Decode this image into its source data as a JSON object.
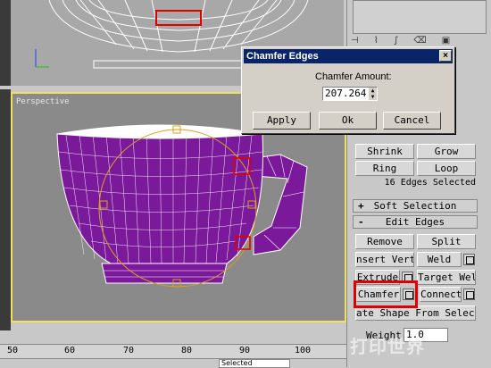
{
  "viewport": {
    "perspective_label": "Perspective"
  },
  "dialog": {
    "title": "Chamfer Edges",
    "amount_label": "Chamfer Amount:",
    "amount_value": "207.264",
    "apply_label": "Apply",
    "ok_label": "Ok",
    "cancel_label": "Cancel",
    "close_glyph": "×"
  },
  "panel": {
    "shrink_label": "Shrink",
    "grow_label": "Grow",
    "ring_label": "Ring",
    "loop_label": "Loop",
    "selection_status": "16 Edges Selected",
    "soft_selection_label": "Soft Selection",
    "soft_selection_glyph": "+",
    "edit_edges_label": "Edit Edges",
    "edit_edges_glyph": "-",
    "remove_label": "Remove",
    "split_label": "Split",
    "insert_vertex_label": "nsert Verte",
    "weld_label": "Weld",
    "extrude_label": "Extrude",
    "target_weld_label": "Target Weld",
    "chamfer_label": "Chamfer",
    "connect_label": "Connect",
    "create_shape_label": "ate Shape From Select",
    "weight_label": "Weight:",
    "weight_value": "1.0"
  },
  "ruler": {
    "ticks": [
      "50",
      "60",
      "70",
      "80",
      "90",
      "100"
    ]
  },
  "status": {
    "selected_value": "Selected"
  },
  "watermark": {
    "text": "打印世界"
  },
  "colors": {
    "cup": "#7a1a9a",
    "highlight": "#e00000",
    "titlebar": "#0a246a"
  }
}
